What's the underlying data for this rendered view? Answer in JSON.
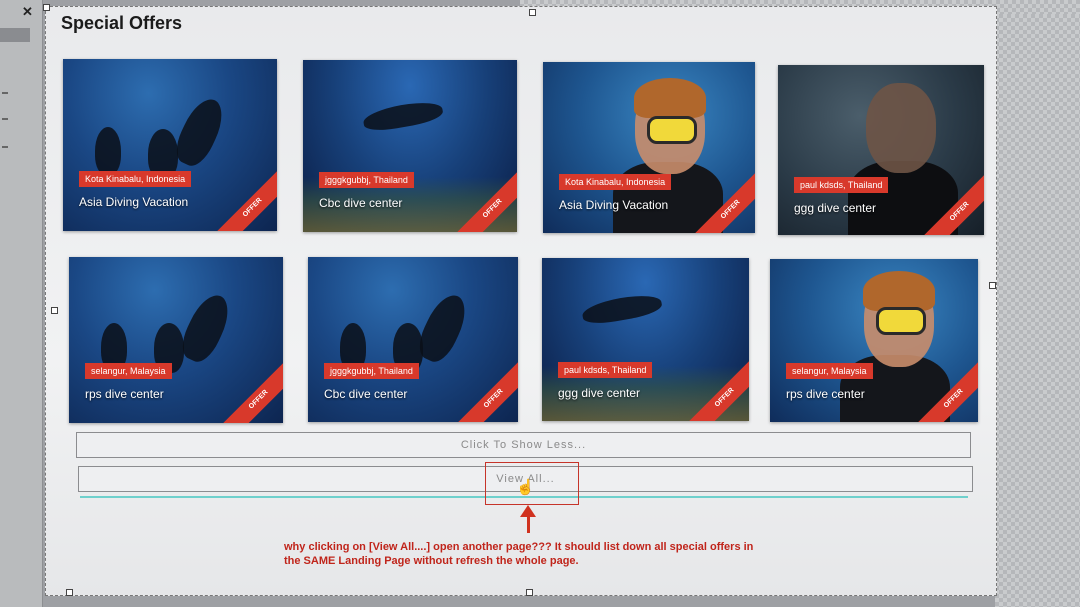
{
  "window": {
    "close_glyph": "✕"
  },
  "section": {
    "title": "Special Offers"
  },
  "offers": [
    {
      "location": "Kota Kinabalu, Indonesia",
      "name": "Asia Diving Vacation",
      "badge": "OFFER"
    },
    {
      "location": "jgggkgubbj, Thailand",
      "name": "Cbc dive center",
      "badge": "OFFER"
    },
    {
      "location": "Kota Kinabalu, Indonesia",
      "name": "Asia Diving Vacation",
      "badge": "OFFER"
    },
    {
      "location": "paul kdsds, Thailand",
      "name": "ggg dive center",
      "badge": "OFFER"
    },
    {
      "location": "selangur, Malaysia",
      "name": "rps dive center",
      "badge": "OFFER"
    },
    {
      "location": "jgggkgubbj, Thailand",
      "name": "Cbc dive center",
      "badge": "OFFER"
    },
    {
      "location": "paul kdsds, Thailand",
      "name": "ggg dive center",
      "badge": "OFFER"
    },
    {
      "location": "selangur, Malaysia",
      "name": "rps dive center",
      "badge": "OFFER"
    }
  ],
  "buttons": {
    "show_less": "Click To Show Less...",
    "view_all": "View All..."
  },
  "annotation": {
    "text": "why clicking on [View All....] open another page??? It should list down all special offers in the SAME Landing Page without refresh the whole page.",
    "color": "#c0251b"
  },
  "colors": {
    "badge": "#d8392b",
    "divider": "#6fd0cc"
  }
}
